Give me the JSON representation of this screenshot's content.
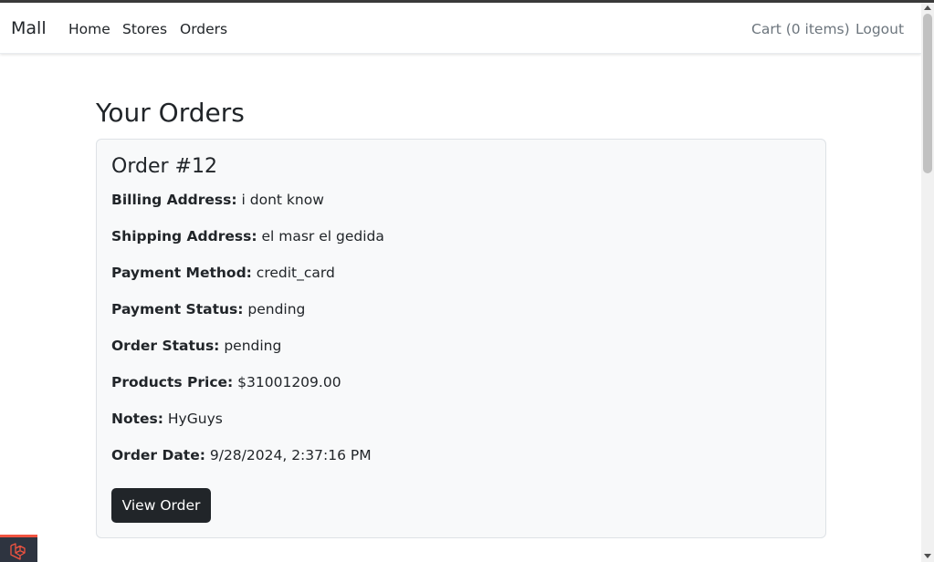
{
  "nav": {
    "brand": "Mall",
    "links": [
      "Home",
      "Stores",
      "Orders"
    ],
    "cart": "Cart (0 items)",
    "logout": "Logout"
  },
  "page": {
    "title": "Your Orders"
  },
  "order": {
    "title": "Order #12",
    "fields": [
      {
        "label": "Billing Address:",
        "value": "i dont know"
      },
      {
        "label": "Shipping Address:",
        "value": "el masr el gedida"
      },
      {
        "label": "Payment Method:",
        "value": "credit_card"
      },
      {
        "label": "Payment Status:",
        "value": "pending"
      },
      {
        "label": "Order Status:",
        "value": "pending"
      },
      {
        "label": "Products Price:",
        "value": "$31001209.00"
      },
      {
        "label": "Notes:",
        "value": "HyGuys"
      },
      {
        "label": "Order Date:",
        "value": "9/28/2024, 2:37:16 PM"
      }
    ],
    "view_button": "View Order"
  },
  "icons": {
    "debug_badge": "laravel-logo-icon"
  },
  "colors": {
    "button_bg": "#212529",
    "card_bg": "#f8f9fa",
    "debug_accent": "#f05340"
  }
}
